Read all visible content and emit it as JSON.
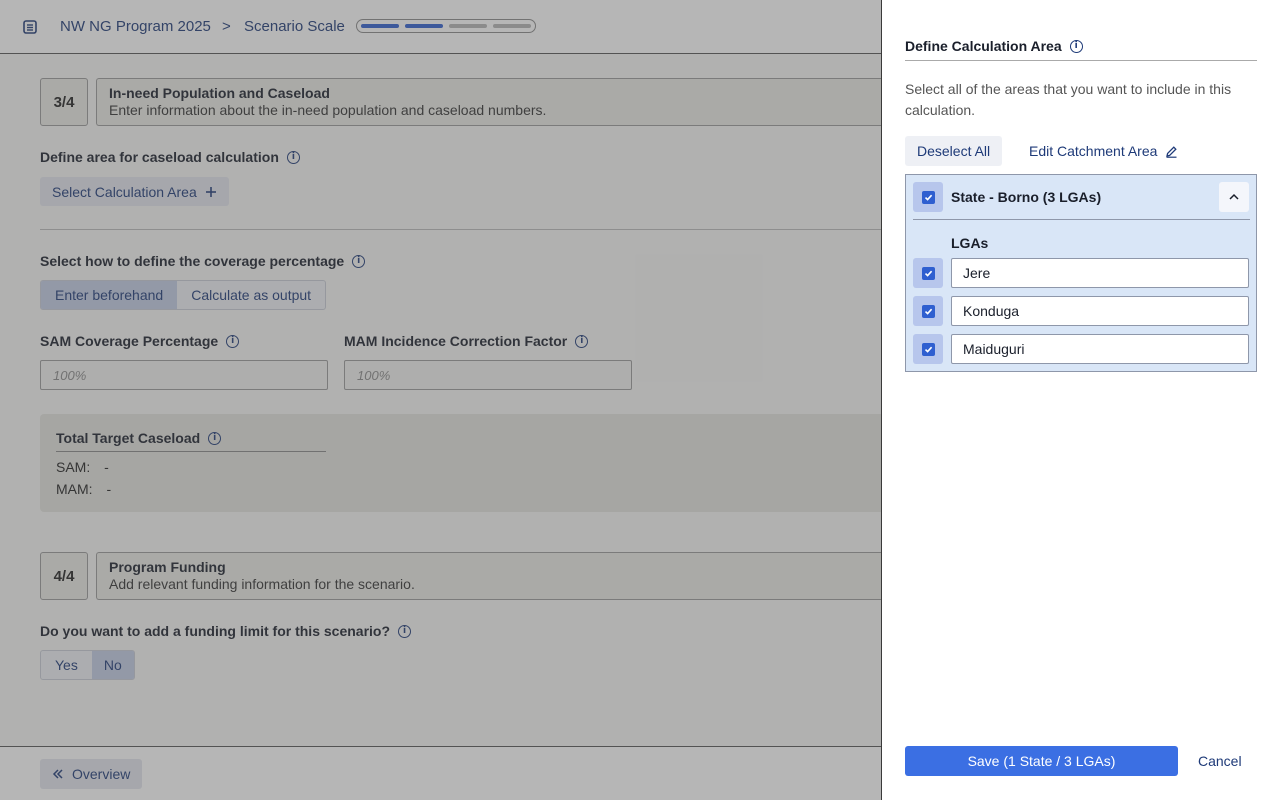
{
  "header": {
    "program": "NW NG Program 2025",
    "separator": ">",
    "scenario": "Scenario Scale",
    "progress": {
      "completed_steps": 2,
      "total_steps": 4
    }
  },
  "step3": {
    "number": "3/4",
    "title": "In-need Population and Caseload",
    "subtitle": "Enter information about the in-need population and caseload numbers.",
    "area_label": "Define area for caseload calculation",
    "area_button": "Select Calculation Area",
    "coverage_label": "Select how to define the coverage percentage",
    "coverage_options": [
      "Enter beforehand",
      "Calculate as output"
    ],
    "coverage_selected": "Enter beforehand",
    "sam_label": "SAM Coverage Percentage",
    "sam_placeholder": "100%",
    "mam_label": "MAM Incidence Correction Factor",
    "mam_placeholder": "100%",
    "caseload_title": "Total Target Caseload",
    "sam_row_label": "SAM:",
    "sam_row_value": "-",
    "mam_row_label": "MAM:",
    "mam_row_value": "-"
  },
  "step4": {
    "number": "4/4",
    "title": "Program Funding",
    "subtitle": "Add relevant funding information for the scenario.",
    "funding_question": "Do you want to add a funding limit for this scenario?",
    "yes": "Yes",
    "no": "No",
    "selected": "No"
  },
  "footer": {
    "overview": "Overview"
  },
  "panel": {
    "title": "Define Calculation Area",
    "description": "Select all of the areas that you want to include in this calculation.",
    "deselect_all": "Deselect All",
    "edit_catchment": "Edit Catchment Area",
    "state": {
      "label": "State - Borno (3 LGAs)",
      "checked": true,
      "expanded": true
    },
    "lga_heading": "LGAs",
    "lgas": [
      {
        "name": "Jere",
        "checked": true
      },
      {
        "name": "Konduga",
        "checked": true
      },
      {
        "name": "Maiduguri",
        "checked": true
      }
    ],
    "save": "Save (1 State / 3 LGAs)",
    "cancel": "Cancel"
  },
  "colors": {
    "primary": "#3b6fe3",
    "accent_text": "#1e3a78",
    "state_bg": "#d9e6f7"
  }
}
